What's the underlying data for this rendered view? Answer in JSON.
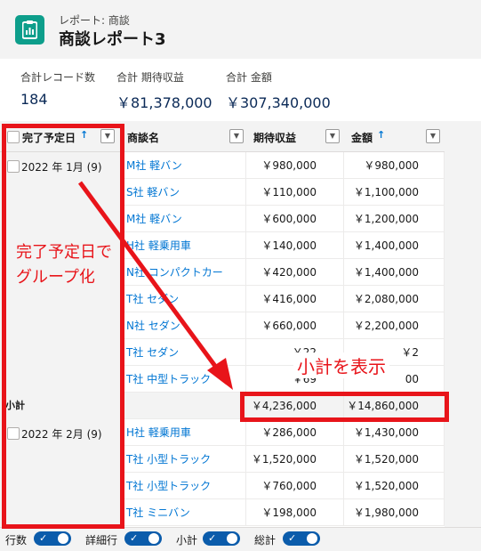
{
  "header": {
    "subtitle": "レポート: 商談",
    "title": "商談レポート3"
  },
  "summary": [
    {
      "label": "合計レコード数",
      "value": "184"
    },
    {
      "label": "合計 期待収益",
      "value": "￥81,378,000"
    },
    {
      "label": "合計 金額",
      "value": "￥307,340,000"
    }
  ],
  "table": {
    "columns": [
      "完了予定日",
      "商談名",
      "期待収益",
      "金額"
    ],
    "groups": [
      {
        "label": "2022 年 1月 (9)",
        "rows": [
          {
            "name": "M社 軽バン",
            "expected": "￥980,000",
            "amount": "￥980,000"
          },
          {
            "name": "S社 軽バン",
            "expected": "￥110,000",
            "amount": "￥1,100,000"
          },
          {
            "name": "M社 軽バン",
            "expected": "￥600,000",
            "amount": "￥1,200,000"
          },
          {
            "name": "H社 軽乗用車",
            "expected": "￥140,000",
            "amount": "￥1,400,000"
          },
          {
            "name": "N社 コンパクトカー",
            "expected": "￥420,000",
            "amount": "￥1,400,000"
          },
          {
            "name": "T社 セダン",
            "expected": "￥416,000",
            "amount": "￥2,080,000"
          },
          {
            "name": "N社 セダン",
            "expected": "￥660,000",
            "amount": "￥2,200,000"
          },
          {
            "name": "T社 セダン",
            "expected": "￥22",
            "amount": "￥2"
          },
          {
            "name": "T社 中型トラック",
            "expected": "￥69",
            "amount": "00"
          }
        ],
        "subtotal": {
          "label": "小計",
          "expected": "￥4,236,000",
          "amount": "￥14,860,000"
        }
      },
      {
        "label": "2022 年 2月 (9)",
        "rows": [
          {
            "name": "H社 軽乗用車",
            "expected": "￥286,000",
            "amount": "￥1,430,000"
          },
          {
            "name": "T社 小型トラック",
            "expected": "￥1,520,000",
            "amount": "￥1,520,000"
          },
          {
            "name": "T社 小型トラック",
            "expected": "￥760,000",
            "amount": "￥1,520,000"
          },
          {
            "name": "T社 ミニバン",
            "expected": "￥198,000",
            "amount": "￥1,980,000"
          }
        ]
      }
    ]
  },
  "footer": [
    "行数",
    "詳細行",
    "小計",
    "総計"
  ],
  "annotations": {
    "group_note": "完了予定日で\nグループ化",
    "subtotal_note": "小計を表示"
  },
  "colors": {
    "accent": "#0176d3",
    "annotation": "#e8141a",
    "app_icon": "#0d9e8b"
  }
}
